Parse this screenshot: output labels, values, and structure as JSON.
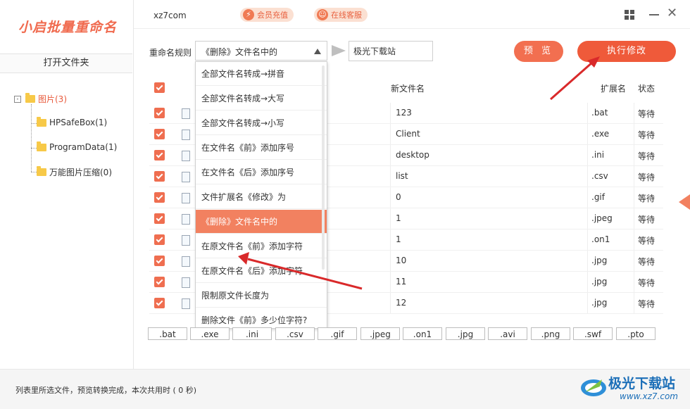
{
  "app": {
    "logo_text": "小启批量重命名",
    "account": "xz7com",
    "vip_label": "会员充值",
    "service_label": "在线客服"
  },
  "sidebar": {
    "open_folder_label": "打开文件夹",
    "tree": {
      "root": {
        "toggle": "-",
        "label": "图片(3)"
      },
      "children": [
        {
          "label": "HPSafeBox(1)"
        },
        {
          "label": "ProgramData(1)"
        },
        {
          "label": "万能图片压缩(0)"
        }
      ]
    }
  },
  "rule": {
    "label": "重命名规则",
    "selected": "《删除》文件名中的",
    "text_value": "极光下载站",
    "preview_label": "预 览",
    "execute_label": "执行修改"
  },
  "dropdown": {
    "options": [
      "全部文件名转成→拼音",
      "全部文件名转成→大写",
      "全部文件名转成→小写",
      "在文件名《前》添加序号",
      "在文件名《后》添加序号",
      "文件扩展名《修改》为",
      "《删除》文件名中的",
      "在原文件名《前》添加字符",
      "在原文件名《后》添加字符",
      "限制原文件长度为",
      "删除文件《前》多少位字符?"
    ],
    "selected_index": 6
  },
  "table": {
    "headers": {
      "new_name": "新文件名",
      "extension": "扩展名",
      "status": "状态"
    },
    "rows": [
      {
        "new_name": "123",
        "ext": ".bat",
        "status": "等待"
      },
      {
        "new_name": "Client",
        "ext": ".exe",
        "status": "等待"
      },
      {
        "new_name": "desktop",
        "ext": ".ini",
        "status": "等待"
      },
      {
        "new_name": "list",
        "ext": ".csv",
        "status": "等待"
      },
      {
        "new_name": "0",
        "ext": ".gif",
        "status": "等待"
      },
      {
        "new_name": "1",
        "ext": ".jpeg",
        "status": "等待"
      },
      {
        "new_name": "1",
        "ext": ".on1",
        "status": "等待"
      },
      {
        "new_name": "10",
        "ext": ".jpg",
        "status": "等待"
      },
      {
        "new_name": "11",
        "ext": ".jpg",
        "status": "等待"
      },
      {
        "new_name": "12",
        "ext": ".jpg",
        "status": "等待"
      }
    ]
  },
  "ext_filters": [
    ".bat",
    ".exe",
    ".ini",
    ".csv",
    ".gif",
    ".jpeg",
    ".on1",
    ".jpg",
    ".avi",
    ".png",
    ".swf",
    ".pto"
  ],
  "status_bar": {
    "text": "列表里所选文件，预览转换完成，本次共用时 ( 0 秒)"
  },
  "watermark": {
    "name": "极光下载站",
    "url": "www.xz7.com"
  },
  "colors": {
    "accent": "#ef5a3a",
    "accent_light": "#f28160",
    "annotation_arrow": "#d9292a"
  },
  "icons": {
    "vip": "lightning-icon",
    "service": "headset-icon",
    "folder": "folder-icon",
    "window_grid": "grid-icon",
    "minimize": "minimize-icon",
    "close": "close-icon"
  }
}
